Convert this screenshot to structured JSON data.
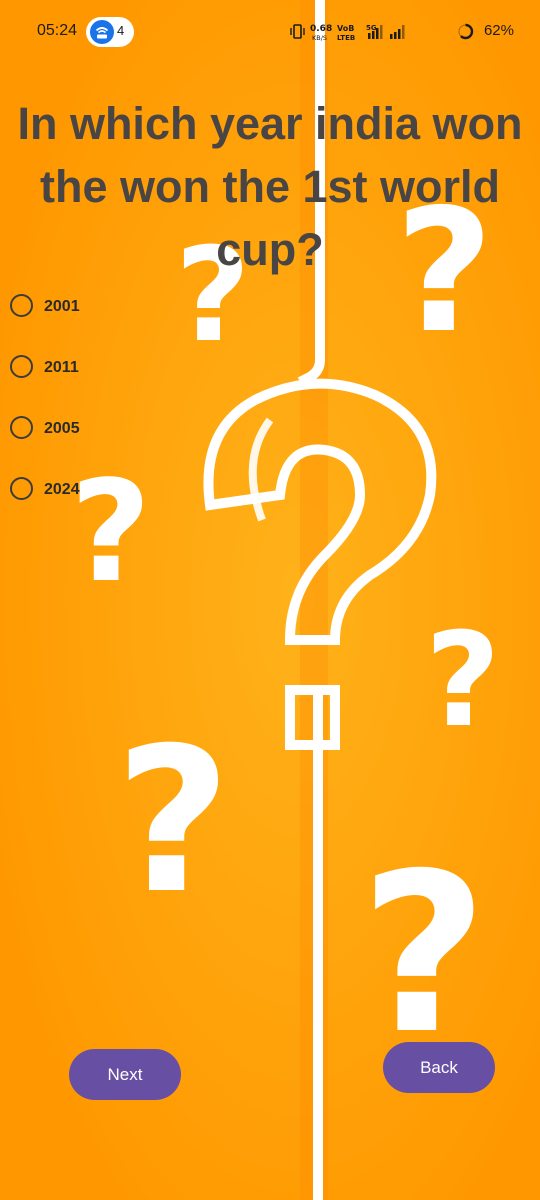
{
  "status_bar": {
    "time": "05:24",
    "hotspot_count": "4",
    "battery": "62%",
    "icons": [
      "vibrate-icon",
      "network-speed-icon",
      "volte-icon",
      "5g-signal-icon",
      "signal-icon",
      "battery-icon",
      "hotspot-icon"
    ]
  },
  "quiz": {
    "question": "In which year india won the won the 1st world cup?",
    "options": [
      "2001",
      "2011",
      "2005",
      "2024"
    ]
  },
  "buttons": {
    "next": "Next",
    "back": "Back"
  },
  "colors": {
    "background": "#FFA200",
    "button": "#6750A4",
    "question_text": "#4a4545"
  }
}
